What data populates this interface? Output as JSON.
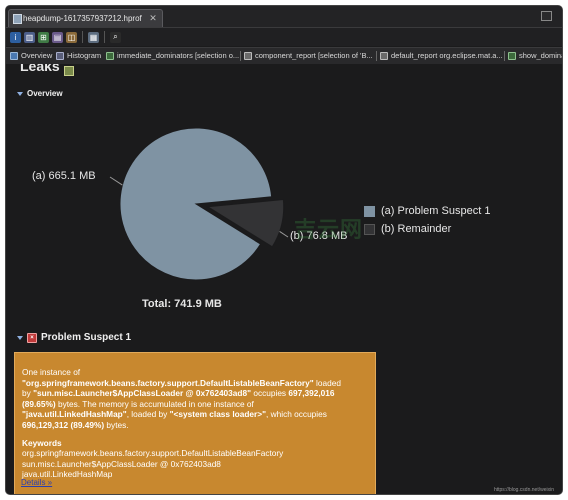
{
  "editor_tab": {
    "title": "heapdump-1617357937212.hprof",
    "close_glyph": "✕"
  },
  "toolbar": {
    "buttons": [
      "info-icon",
      "histogram-icon",
      "dominator-icon",
      "query-icon",
      "oql-icon",
      "report-icon",
      "search-icon"
    ]
  },
  "query_tabs": [
    {
      "label": "Overview",
      "icon": "overview-icon"
    },
    {
      "label": "Histogram",
      "icon": "histogram-icon"
    },
    {
      "label": "immediate_dominators  [selection o...",
      "icon": "dominator-icon"
    },
    {
      "label": "component_report  [selection of 'B...",
      "icon": "report-icon"
    },
    {
      "label": "default_report  org.eclipse.mat.a...",
      "icon": "report-icon"
    },
    {
      "label": "show_dominato",
      "icon": "dominator-icon"
    }
  ],
  "page": {
    "title": "Leaks",
    "overview_heading": "Overview",
    "suspect_heading": "Problem Suspect 1"
  },
  "chart_data": {
    "type": "pie",
    "total_label": "Total: 741.9 MB",
    "slices": [
      {
        "label": "(a)  665.1 MB",
        "name": "Problem Suspect 1",
        "value": 665.1,
        "color": "#7f93a3"
      },
      {
        "label": "(b)  76.8 MB",
        "name": "Remainder",
        "value": 76.8,
        "color": "#333335"
      }
    ],
    "legend": [
      "(a)  Problem Suspect 1",
      "(b)  Remainder"
    ],
    "legend_position": "right"
  },
  "watermark": "吉云网",
  "suspect": {
    "line1": "One instance of",
    "class_name": "\"org.springframework.beans.factory.support.DefaultListableBeanFactory\"",
    "loaded_by": " loaded",
    "by": "by ",
    "loader": "\"sun.misc.Launcher$AppClassLoader @ 0x762403ad8\"",
    "occupies": " occupies ",
    "bytes1": "697,392,016",
    "pct1": "(89.65%)",
    "mid": " bytes. The memory is accumulated in one instance of",
    "map_class": "\"java.util.LinkedHashMap\"",
    "loaded_by2": ", loaded by ",
    "sys_loader": "\"<system class loader>\"",
    "which": ", which occupies",
    "bytes2": "696,129,312 (89.49%)",
    "end": " bytes.",
    "keywords_title": "Keywords",
    "keywords": [
      "org.springframework.beans.factory.support.DefaultListableBeanFactory",
      "sun.misc.Launcher$AppClassLoader @ 0x762403ad8",
      "java.util.LinkedHashMap"
    ],
    "details_link": "Details »"
  },
  "footer_credit": "https://blog.csdn.net/weixin"
}
